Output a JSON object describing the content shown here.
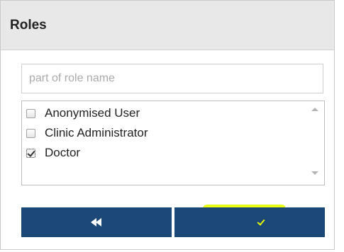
{
  "panel": {
    "title": "Roles"
  },
  "search": {
    "placeholder": "part of role name",
    "value": ""
  },
  "roles": [
    {
      "label": "Anonymised User",
      "checked": false
    },
    {
      "label": "Clinic Administrator",
      "checked": false
    },
    {
      "label": "Doctor",
      "checked": true
    }
  ],
  "buttons": {
    "remove_selected": {
      "icon": "double-left-arrow-icon"
    },
    "remove_all_checked": {
      "icons": [
        "double-left-arrow-icon",
        "plus-icon",
        "checkbox-checked-icon"
      ],
      "plus_text": "+"
    }
  },
  "colors": {
    "button_background": "#1c4878",
    "header_background": "#e8e8e8",
    "highlight": "#e8ff00"
  }
}
